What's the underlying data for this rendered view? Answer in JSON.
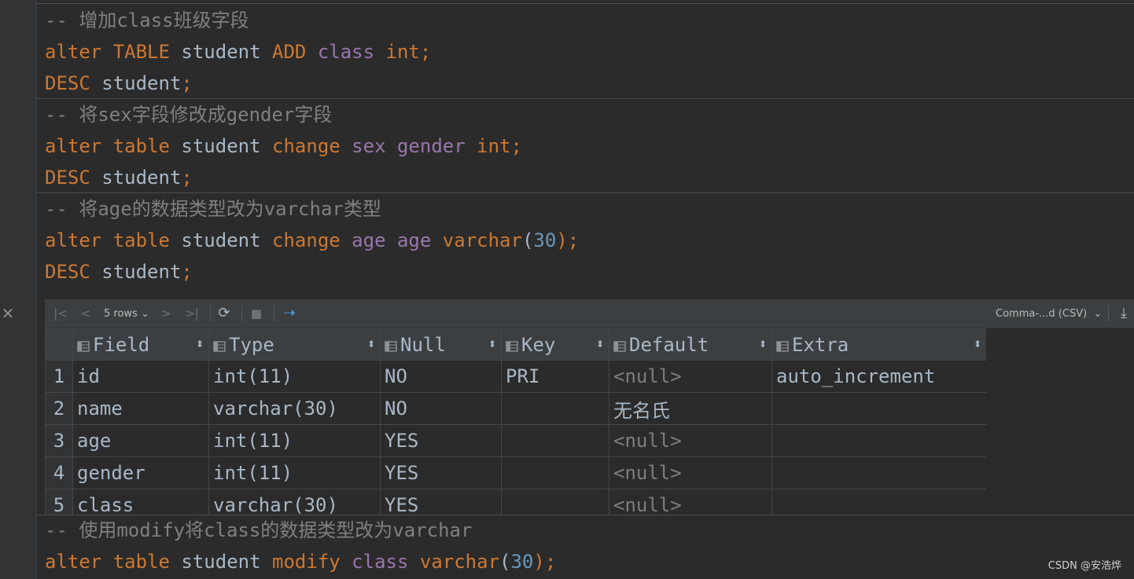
{
  "editor": {
    "lines": [
      {
        "comment": "-- 增加class班级字段"
      },
      {
        "kw1": "alter",
        "kw2": "TABLE",
        "tbl": "student",
        "kw3": "ADD",
        "col": "class",
        "type": "int",
        "end": ";"
      },
      {
        "kw": "DESC",
        "tbl": "student",
        "end": ";"
      },
      {
        "comment": "-- 将sex字段修改成gender字段"
      },
      {
        "kw1": "alter",
        "kw2": "table",
        "tbl": "student",
        "kw3": "change",
        "col1": "sex",
        "col2": "gender",
        "type": "int",
        "end": ";"
      },
      {
        "kw": "DESC",
        "tbl": "student",
        "end": ";"
      },
      {
        "comment": "-- 将age的数据类型改为varchar类型"
      },
      {
        "kw1": "alter",
        "kw2": "table",
        "tbl": "student",
        "kw3": "change",
        "col1": "age",
        "col2": "age",
        "type": "varchar",
        "open": "(",
        "num": "30",
        "close": ");"
      },
      {
        "kw": "DESC",
        "tbl": "student",
        "end": ";"
      },
      {
        "comment": "-- 使用modify将class的数据类型改为varchar"
      },
      {
        "kw1": "alter",
        "kw2": "table",
        "tbl": "student",
        "kw3": "modify",
        "col": "class",
        "type": "varchar",
        "open": "(",
        "num": "30",
        "close": ");"
      }
    ]
  },
  "results": {
    "toolbar": {
      "first": "|<",
      "prev": "<",
      "rows_label": "5 rows",
      "rows_caret": "⌄",
      "next": ">",
      "last": ">|",
      "refresh": "⟳",
      "stop": "■",
      "pin": "⇢",
      "format_label": "Comma-...d (CSV)",
      "format_caret": "⌄",
      "download": "⤓"
    },
    "columns": [
      "Field",
      "Type",
      "Null",
      "Key",
      "Default",
      "Extra"
    ],
    "rows": [
      {
        "n": "1",
        "field": "id",
        "type": "int(11)",
        "null": "NO",
        "key": "PRI",
        "default": "<null>",
        "extra": "auto_increment"
      },
      {
        "n": "2",
        "field": "name",
        "type": "varchar(30)",
        "null": "NO",
        "key": "",
        "default": "无名氏",
        "extra": ""
      },
      {
        "n": "3",
        "field": "age",
        "type": "int(11)",
        "null": "YES",
        "key": "",
        "default": "<null>",
        "extra": ""
      },
      {
        "n": "4",
        "field": "gender",
        "type": "int(11)",
        "null": "YES",
        "key": "",
        "default": "<null>",
        "extra": ""
      },
      {
        "n": "5",
        "field": "class",
        "type": "varchar(30)",
        "null": "YES",
        "key": "",
        "default": "<null>",
        "extra": ""
      }
    ]
  },
  "gutter": {
    "close_glyph": "✕"
  },
  "watermark": "CSDN @安浩烨",
  "colors": {
    "keyword": "#cc7832",
    "identifier": "#a9b7c6",
    "column": "#9876aa",
    "number": "#6897bb",
    "comment": "#808080"
  }
}
